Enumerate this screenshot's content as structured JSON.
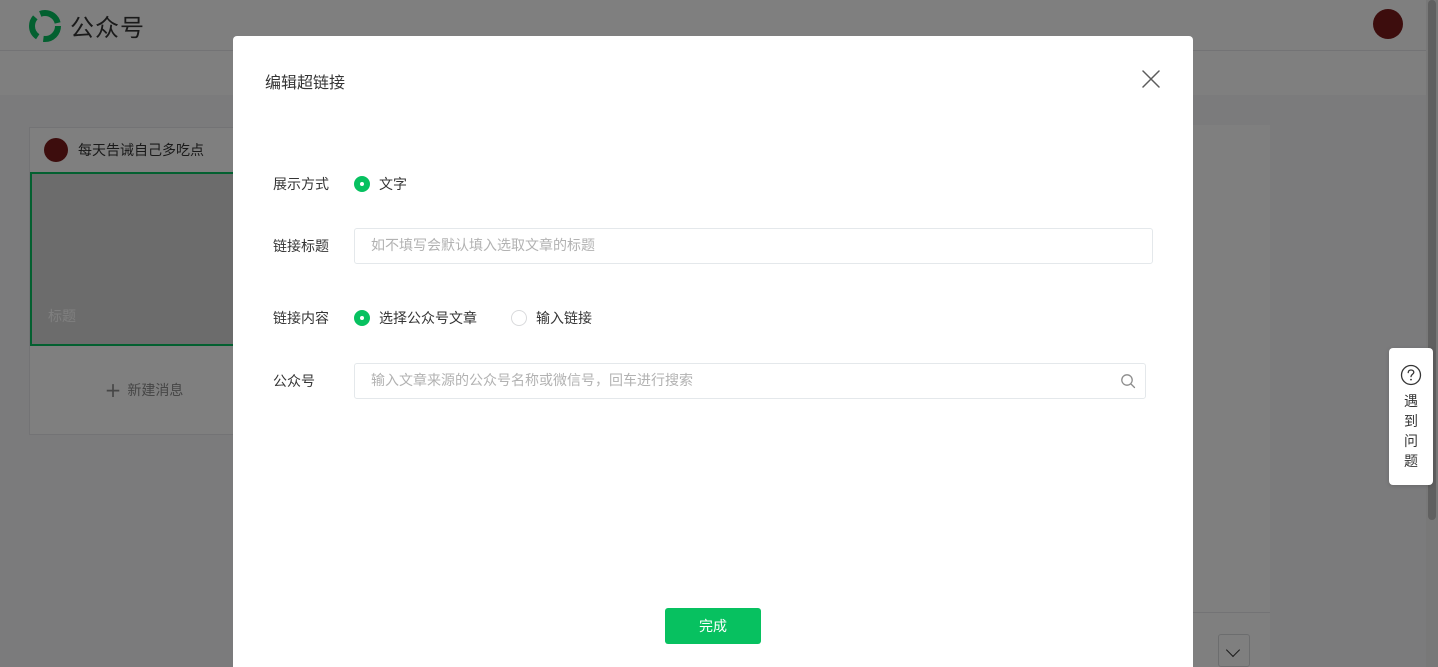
{
  "app": {
    "name": "公众号"
  },
  "editor": {
    "account_name": "每天告诫自己多吃点",
    "cover_title_placeholder": "标题",
    "new_message_label": "新建消息"
  },
  "help": {
    "label": "遇到问题"
  },
  "dialog": {
    "title": "编辑超链接",
    "display_mode": {
      "label": "展示方式",
      "options": [
        {
          "label": "文字",
          "checked": true
        }
      ]
    },
    "link_title": {
      "label": "链接标题",
      "value": "",
      "placeholder": "如不填写会默认填入选取文章的标题"
    },
    "link_content": {
      "label": "链接内容",
      "options": [
        {
          "label": "选择公众号文章",
          "checked": true
        },
        {
          "label": "输入链接",
          "checked": false
        }
      ]
    },
    "account_search": {
      "label": "公众号",
      "value": "",
      "placeholder": "输入文章来源的公众号名称或微信号，回车进行搜索"
    },
    "done_label": "完成"
  },
  "colors": {
    "brand_green": "#07c160",
    "mask": "rgba(0,0,0,0.5)"
  }
}
